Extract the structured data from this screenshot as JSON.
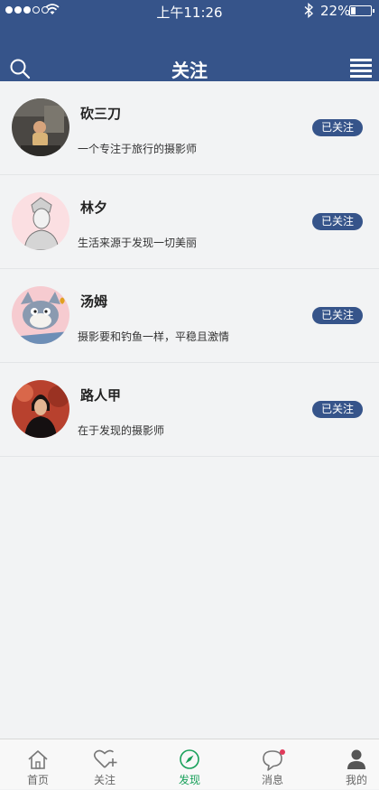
{
  "status_bar": {
    "time": "上午11:26",
    "battery": "22%"
  },
  "header": {
    "title": "关注"
  },
  "follows": [
    {
      "name": "砍三刀",
      "description": "一个专注于旅行的摄影师",
      "status": "已关注"
    },
    {
      "name": "林夕",
      "description": "生活来源于发现一切美丽",
      "status": "已关注"
    },
    {
      "name": "汤姆",
      "description": "摄影要和钓鱼一样，平稳且激情",
      "status": "已关注"
    },
    {
      "name": "路人甲",
      "description": "在于发现的摄影师",
      "status": "已关注"
    }
  ],
  "tabs": [
    {
      "label": "首页",
      "icon": "home-icon"
    },
    {
      "label": "关注",
      "icon": "heart-plus-icon"
    },
    {
      "label": "发现",
      "icon": "compass-icon",
      "active": true
    },
    {
      "label": "消息",
      "icon": "chat-icon"
    },
    {
      "label": "我的",
      "icon": "user-icon"
    }
  ],
  "colors": {
    "brand": "#36548a",
    "active": "#18a05a"
  }
}
